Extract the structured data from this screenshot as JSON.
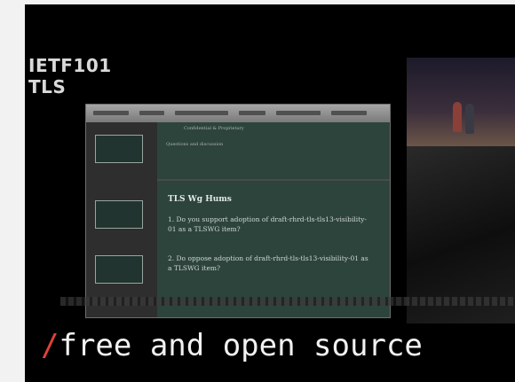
{
  "stream": {
    "line1": "IETF101",
    "line2": "TLS"
  },
  "slide": {
    "top_line1": "Confidential & Proprietary",
    "top_line2": "Questions and discussion",
    "title": "TLS Wg Hums",
    "item1": "1.  Do you support adoption of draft-rhrd-tls-tls13-visibility-01 as a TLSWG item?",
    "item2": "2.  Do oppose adoption of draft-rhrd-tls-tls13-visibility-01 as a TLSWG item?"
  },
  "caption": {
    "slash": "/",
    "text": "free and open source"
  },
  "colors": {
    "accent": "#e0423a",
    "slide_bg": "#2d443d"
  }
}
